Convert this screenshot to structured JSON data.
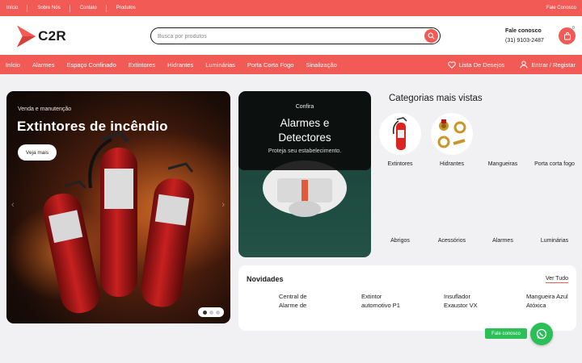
{
  "colors": {
    "brand": "#f25a55",
    "whatsapp": "#2bbf57",
    "text": "#1b1b1b",
    "background": "#f1f1f3"
  },
  "topbar": {
    "links": [
      "Início",
      "Sobre Nós",
      "Contato",
      "Produtos"
    ],
    "contact": "Fale Conosco"
  },
  "header": {
    "logo_text": "C2R",
    "search_placeholder": "Busca por produtos",
    "contact_title": "Fale conosco",
    "contact_phone": "(31) 9103-2487",
    "cart_count": "0"
  },
  "nav": {
    "items": [
      "Início",
      "Alarmes",
      "Espaço Confinado",
      "Extintores",
      "Hidrantes",
      "Luminárias",
      "Porta Corta Fogo",
      "Sinalização"
    ],
    "wishlist": "Lista De Desejos",
    "login": "Entrar / Registar"
  },
  "hero": {
    "eyebrow": "Venda e manutenção",
    "title": "Extintores de incêndio",
    "button": "Veja mais",
    "slides": 3,
    "active_slide": 1
  },
  "promo": {
    "eyebrow": "Confira",
    "title_line1": "Alarmes e",
    "title_line2": "Detectores",
    "subtitle": "Proteja seu estabelecimento."
  },
  "categories": {
    "title": "Categorias mais vistas",
    "items": [
      {
        "label": "Extintores",
        "icon": "fire-extinguisher-icon"
      },
      {
        "label": "Hidrantes",
        "icon": "hydrant-valve-icon"
      },
      {
        "label": "Mangueiras",
        "icon": ""
      },
      {
        "label": "Porta corta fogo",
        "icon": ""
      },
      {
        "label": "Abrigos",
        "icon": ""
      },
      {
        "label": "Acessórios",
        "icon": ""
      },
      {
        "label": "Alarmes",
        "icon": ""
      },
      {
        "label": "Luminárias",
        "icon": ""
      }
    ]
  },
  "news": {
    "title": "Novidades",
    "see_all": "Ver Tudo",
    "products": [
      "Central de Alarme de",
      "Extintor automotivo P1",
      "Insuflador Exaustor VX",
      "Mangueira Azul Atóxica"
    ]
  },
  "chat": {
    "label": "Fale conosco"
  }
}
